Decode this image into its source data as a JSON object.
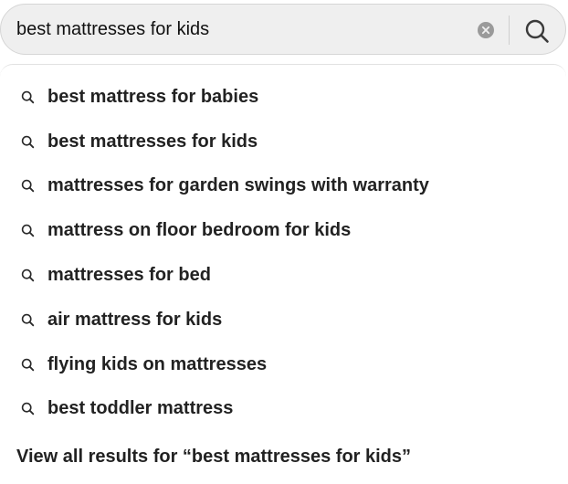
{
  "search": {
    "value": "best mattresses for kids",
    "clear_icon": "clear-circle-x-icon",
    "submit_icon": "search-magnifier-icon"
  },
  "suggestions": [
    {
      "label": "best mattress for babies",
      "icon": "search-icon"
    },
    {
      "label": "best mattresses for kids",
      "icon": "search-icon"
    },
    {
      "label": "mattresses for garden swings with warranty",
      "icon": "search-icon"
    },
    {
      "label": "mattress on floor bedroom for kids",
      "icon": "search-icon"
    },
    {
      "label": "mattresses for bed",
      "icon": "search-icon"
    },
    {
      "label": "air mattress for kids",
      "icon": "search-icon"
    },
    {
      "label": "flying kids on mattresses",
      "icon": "search-icon"
    },
    {
      "label": "best toddler mattress",
      "icon": "search-icon"
    }
  ],
  "view_all": {
    "label": "View all results for “best mattresses for kids”"
  },
  "colors": {
    "search_bar_bg": "#efefef",
    "text": "#222222",
    "caret": "#d0021b"
  }
}
